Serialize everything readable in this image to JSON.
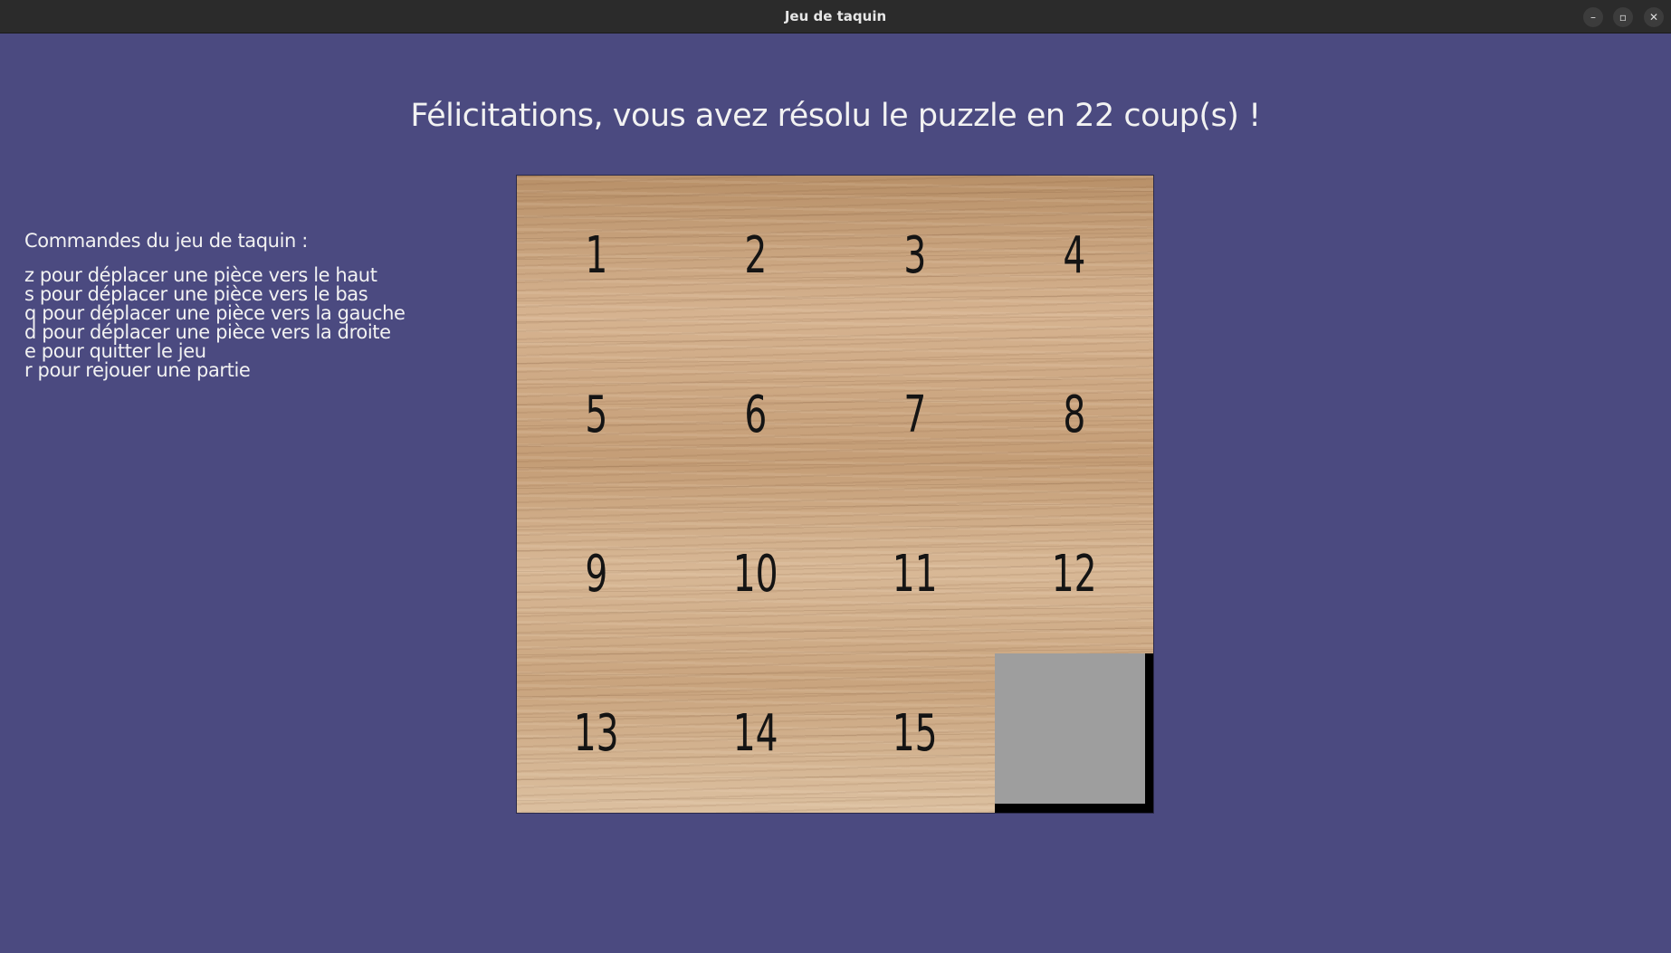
{
  "window": {
    "title": "Jeu de taquin",
    "buttons": {
      "minimize": "–",
      "maximize": "▫",
      "close": "✕"
    }
  },
  "message": "Félicitations, vous avez résolu le puzzle en 22 coup(s) !",
  "controls": {
    "title": "Commandes du jeu de taquin :",
    "lines": [
      "z pour déplacer une pièce vers le haut",
      "s pour déplacer une pièce vers le bas",
      "q pour déplacer une pièce vers la gauche",
      "d pour déplacer une pièce vers la droite",
      "e pour quitter le jeu",
      "r pour rejouer une partie"
    ]
  },
  "board": {
    "rows": 4,
    "cols": 4,
    "tiles": [
      [
        "1",
        "2",
        "3",
        "4"
      ],
      [
        "5",
        "6",
        "7",
        "8"
      ],
      [
        "9",
        "10",
        "11",
        "12"
      ],
      [
        "13",
        "14",
        "15",
        ""
      ]
    ],
    "colors": {
      "empty_tile": "#9e9e9e",
      "background": "#4b4a80"
    }
  }
}
